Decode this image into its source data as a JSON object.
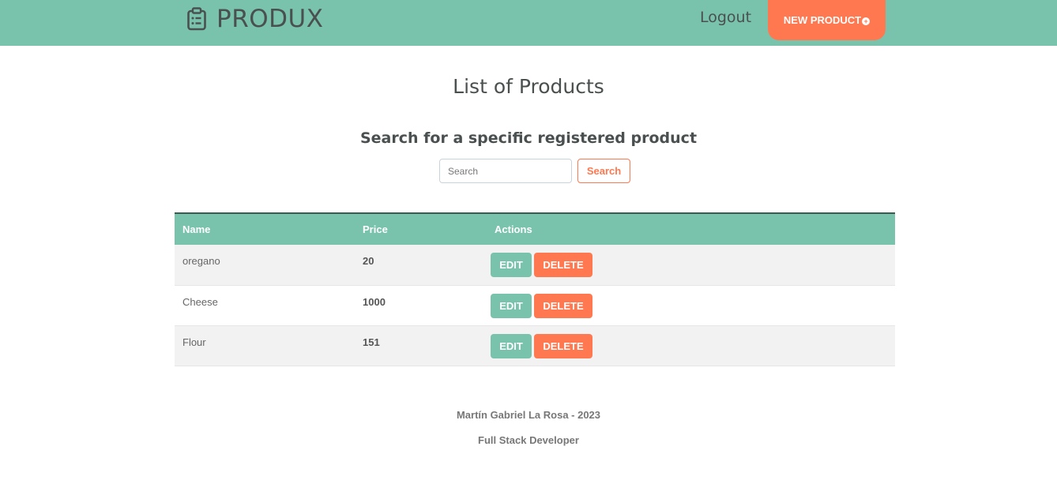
{
  "header": {
    "brand": "PRODUX",
    "brand_icon": "clipboard-list-icon",
    "logout_label": "Logout",
    "new_product_label": "NEW PRODUCT",
    "new_product_icon": "plus-circle-icon",
    "colors": {
      "bar": "#79c3ad",
      "accent": "#ff7850"
    }
  },
  "main": {
    "title": "List of Products",
    "search_heading": "Search for a specific registered product",
    "search": {
      "placeholder": "Search",
      "value": "",
      "button_label": "Search"
    }
  },
  "table": {
    "columns": [
      "Name",
      "Price",
      "Actions"
    ],
    "rows": [
      {
        "name": "oregano",
        "price": "20",
        "edit_label": "EDIT",
        "delete_label": "DELETE"
      },
      {
        "name": "Cheese",
        "price": "1000",
        "edit_label": "EDIT",
        "delete_label": "DELETE"
      },
      {
        "name": "Flour",
        "price": "151",
        "edit_label": "EDIT",
        "delete_label": "DELETE"
      }
    ]
  },
  "footer": {
    "author": "Martín Gabriel La Rosa - 2023",
    "role": "Full Stack Developer"
  }
}
